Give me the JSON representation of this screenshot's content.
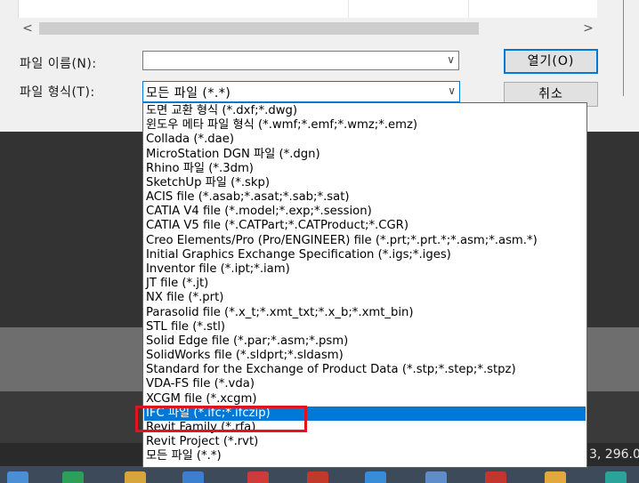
{
  "dialog": {
    "hscroll_left": "<",
    "hscroll_right": ">",
    "filename_label": "파일 이름(N):",
    "filename_value": "",
    "filetype_label": "파일 형식(T):",
    "filetype_value": "모든 파일 (*.*)",
    "open_label": "열기(O)",
    "cancel_label": "취소"
  },
  "file_types": [
    "도면 교환 형식 (*.dxf;*.dwg)",
    "윈도우 메타 파일 형식 (*.wmf;*.emf;*.wmz;*.emz)",
    "Collada (*.dae)",
    "MicroStation DGN 파일 (*.dgn)",
    "Rhino 파일 (*.3dm)",
    "SketchUp 파일 (*.skp)",
    "ACIS file (*.asab;*.asat;*.sab;*.sat)",
    "CATIA V4 file (*.model;*.exp;*.session)",
    "CATIA V5 file (*.CATPart;*.CATProduct;*.CGR)",
    "Creo Elements/Pro (Pro/ENGINEER) file (*.prt;*.prt.*;*.asm;*.asm.*)",
    "Initial Graphics Exchange Specification (*.igs;*.iges)",
    "Inventor file (*.ipt;*.iam)",
    "JT file (*.jt)",
    "NX file (*.prt)",
    "Parasolid file (*.x_t;*.xmt_txt;*.x_b;*.xmt_bin)",
    "STL file (*.stl)",
    "Solid Edge file (*.par;*.asm;*.psm)",
    "SolidWorks file (*.sldprt;*.sldasm)",
    "Standard for the Exchange of Product Data (*.stp;*.step;*.stpz)",
    "VDA-FS file (*.vda)",
    "XCGM file (*.xcgm)",
    "IFC 파일 (*.ifc;*.ifczip)",
    "Revit Family (*.rfa)",
    "Revit Project (*.rvt)",
    "모든 파일 (*.*)"
  ],
  "selected_index": 21,
  "status": {
    "coords": "3, 296.0"
  },
  "colors": {
    "selection": "#0078d7",
    "annotation": "#e0141e"
  },
  "icons": {
    "chevron": "chevron-down-icon"
  }
}
